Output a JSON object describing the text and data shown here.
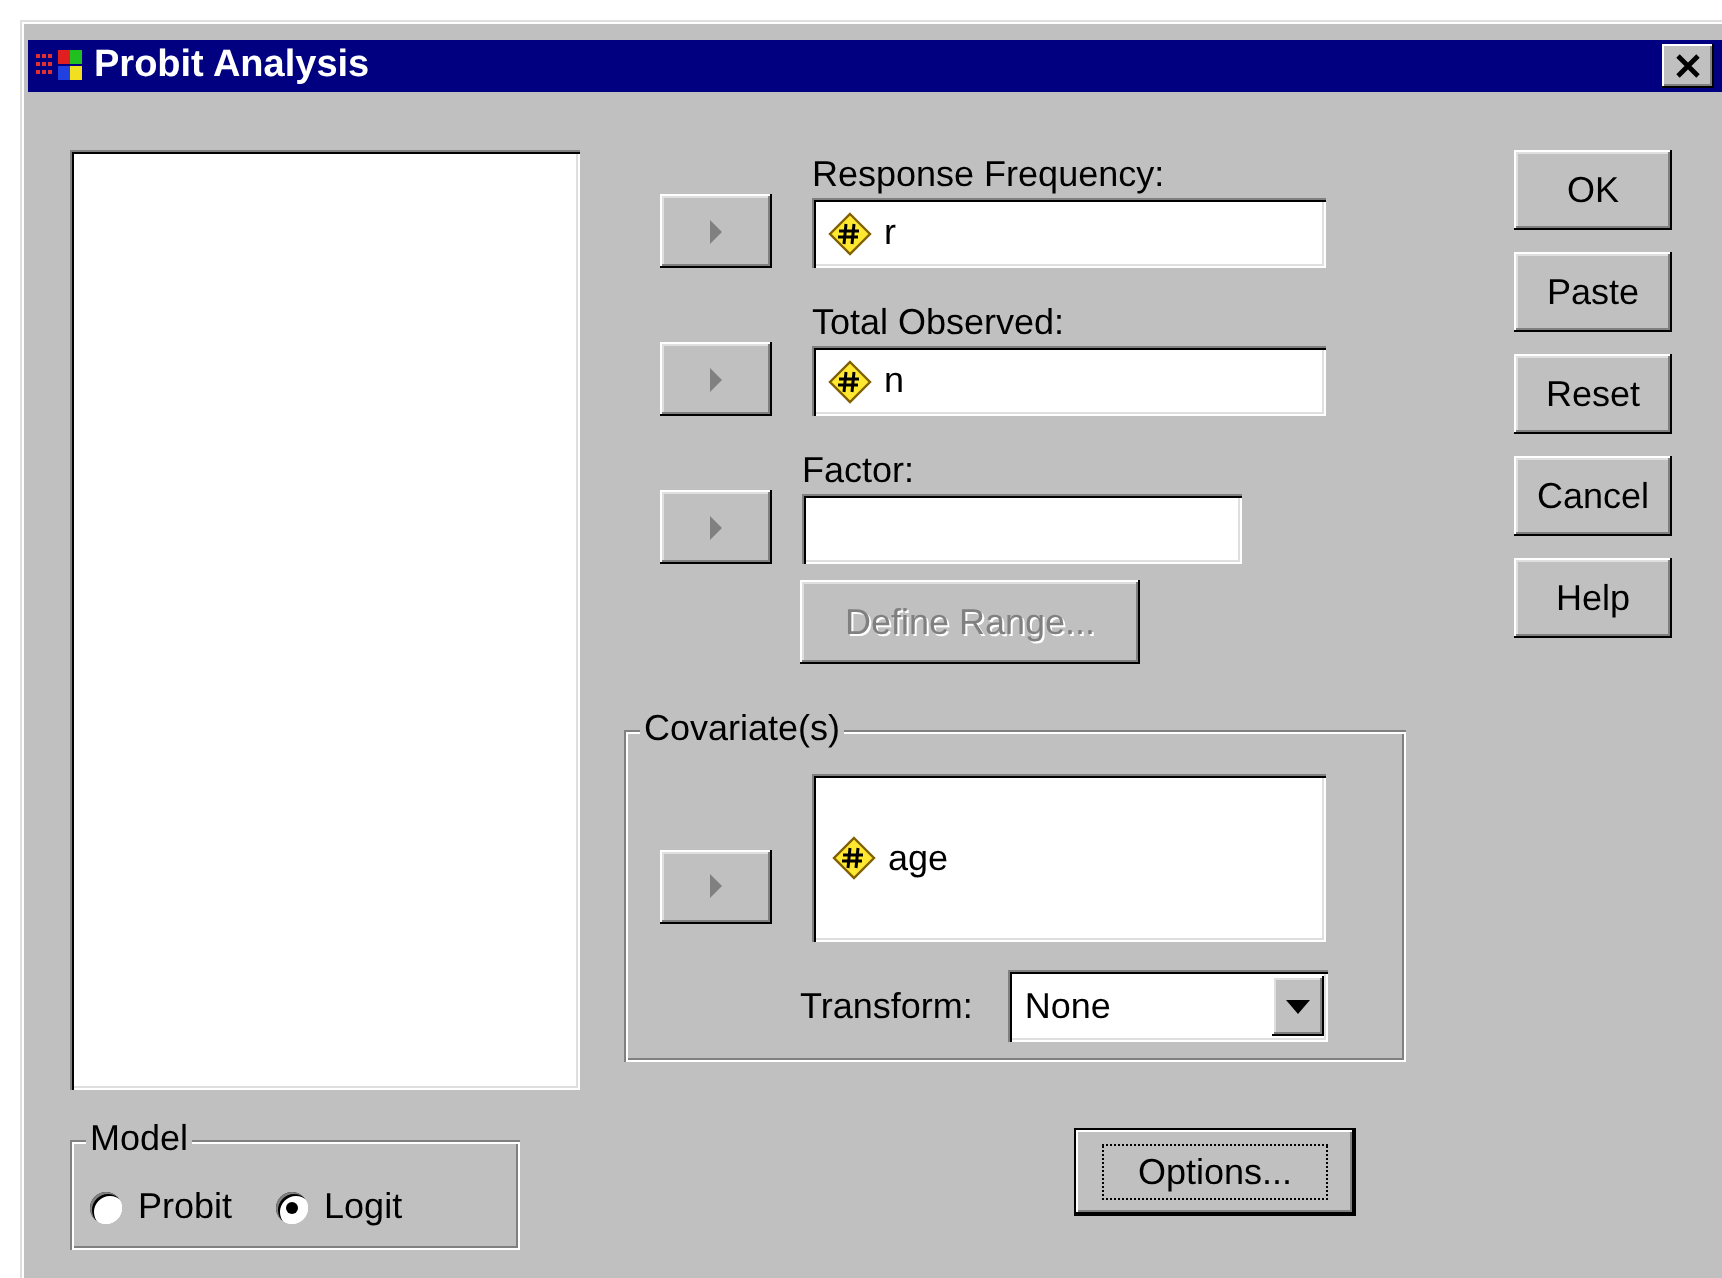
{
  "window": {
    "title": "Probit Analysis"
  },
  "fields": [
    {
      "label": "Response Frequency:",
      "value": "r",
      "arrow_disabled": true
    },
    {
      "label": "Total Observed:",
      "value": "n",
      "arrow_disabled": true
    },
    {
      "label": "Factor:",
      "arrow_disabled": true
    }
  ],
  "define_range": {
    "label": "Define Range...",
    "disabled": true
  },
  "covariates": {
    "title": "Covariate(s)",
    "arrow_disabled": true,
    "items": [
      "age"
    ],
    "transform": {
      "label": "Transform:",
      "value": "None"
    }
  },
  "options_button": {
    "label": "Options...",
    "focused": true
  },
  "buttons": [
    {
      "label": "OK"
    },
    {
      "label": "Paste"
    },
    {
      "label": "Reset"
    },
    {
      "label": "Cancel"
    },
    {
      "label": "Help"
    }
  ],
  "model": {
    "title": "Model",
    "options": [
      {
        "label": "Probit",
        "selected": false
      },
      {
        "label": "Logit",
        "selected": true
      }
    ]
  }
}
